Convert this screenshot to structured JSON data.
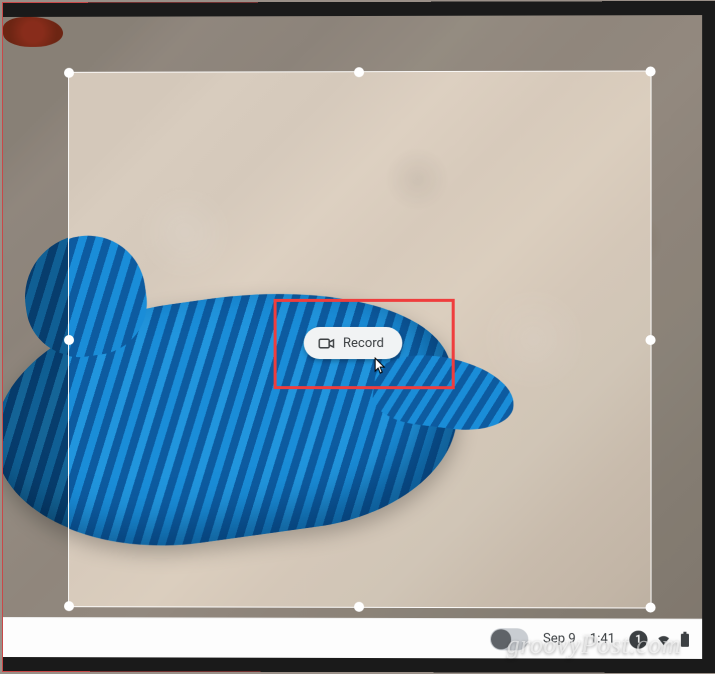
{
  "record_button": {
    "label": "Record"
  },
  "taskbar": {
    "date": "Sep 9",
    "time": "1:41",
    "notification_count": "1"
  },
  "watermark": "groovyPost.com",
  "colors": {
    "highlight": "#ef3d3d",
    "toy": "#1a7cc8"
  }
}
